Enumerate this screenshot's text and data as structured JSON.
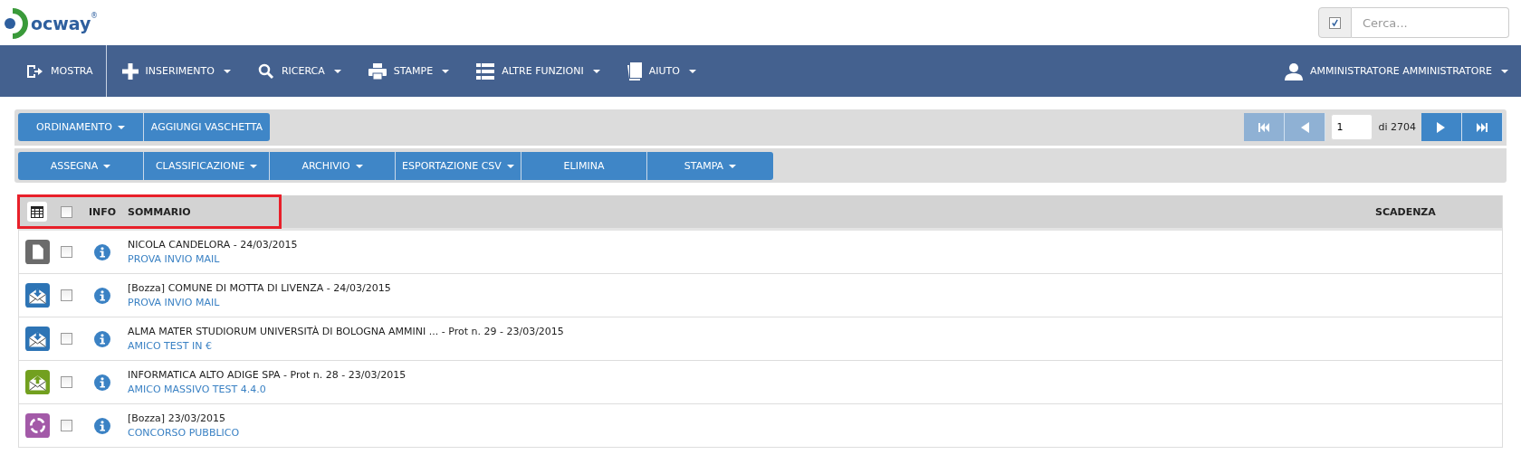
{
  "header": {
    "logo": {
      "text": "ocway",
      "mark": "®"
    },
    "search": {
      "checked": true,
      "placeholder": "Cerca..."
    }
  },
  "nav": {
    "items": [
      {
        "label": "MOSTRA",
        "kind": "exit",
        "dropdown": false
      },
      {
        "label": "INSERIMENTO",
        "kind": "plus",
        "dropdown": true
      },
      {
        "label": "RICERCA",
        "kind": "search",
        "dropdown": true
      },
      {
        "label": "STAMPE",
        "kind": "print",
        "dropdown": true
      },
      {
        "label": "ALTRE FUNZIONI",
        "kind": "list",
        "dropdown": true
      },
      {
        "label": "AIUTO",
        "kind": "book",
        "dropdown": true
      }
    ],
    "user": {
      "label": "AMMINISTRATORE AMMINISTRATORE",
      "dropdown": true
    }
  },
  "toolbar": {
    "row_1": [
      {
        "label": "ORDINAMENTO",
        "dropdown": true
      },
      {
        "label": "AGGIUNGI VASCHETTA",
        "dropdown": false
      }
    ],
    "row_2": [
      {
        "label": "ASSEGNA",
        "dropdown": true
      },
      {
        "label": "CLASSIFICAZIONE",
        "dropdown": true
      },
      {
        "label": "ARCHIVIO",
        "dropdown": true
      },
      {
        "label": "ESPORTAZIONE CSV",
        "dropdown": true
      },
      {
        "label": "ELIMINA",
        "dropdown": false
      },
      {
        "label": "STAMPA",
        "dropdown": true
      }
    ],
    "pager": {
      "buttons": [
        {
          "kind": "first",
          "disabled": true
        },
        {
          "kind": "prev",
          "disabled": true
        }
      ],
      "page": "1",
      "total": "di 2704",
      "buttons_after": [
        {
          "kind": "next",
          "disabled": false
        },
        {
          "kind": "last",
          "disabled": false
        }
      ]
    }
  },
  "table": {
    "header_highlighted": true,
    "select_all_checked": false,
    "columns": [
      "INFO",
      "SOMMARIO",
      "SCADENZA"
    ],
    "rows": [
      {
        "kind": "document",
        "checked": false,
        "title": "NICOLA CANDELORA - 24/03/2015",
        "subject": "PROVA INVIO MAIL"
      },
      {
        "kind": "mail_in",
        "checked": false,
        "title": "[Bozza] COMUNE DI MOTTA DI LIVENZA - 24/03/2015",
        "subject": "PROVA INVIO MAIL"
      },
      {
        "kind": "mail_in",
        "checked": false,
        "title": "ALMA MATER STUDIORUM UNIVERSITÀ DI BOLOGNA AMMINI ... - Prot n. 29 - 23/03/2015",
        "subject": "AMICO TEST IN €"
      },
      {
        "kind": "mail_out",
        "checked": false,
        "title": "INFORMATICA ALTO ADIGE SPA - Prot n. 28 - 23/03/2015",
        "subject": "AMICO MASSIVO TEST 4.4.0"
      },
      {
        "kind": "cycle",
        "checked": false,
        "title": "[Bozza] 23/03/2015",
        "subject": "CONCORSO PUBBLICO"
      }
    ]
  }
}
